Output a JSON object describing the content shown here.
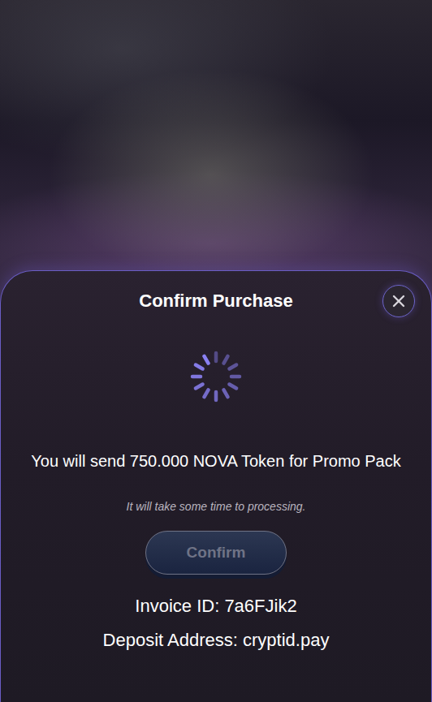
{
  "sheet": {
    "title": "Confirm Purchase",
    "spinner": {
      "loading": true
    },
    "message": "You will send 750.000 NOVA Token for Promo Pack",
    "note": "It will take some time to processing.",
    "confirm_button": {
      "label": "Confirm",
      "disabled": true
    },
    "invoice": "Invoice ID: 7a6FJik2",
    "deposit": "Deposit Address: cryptid.pay"
  }
}
